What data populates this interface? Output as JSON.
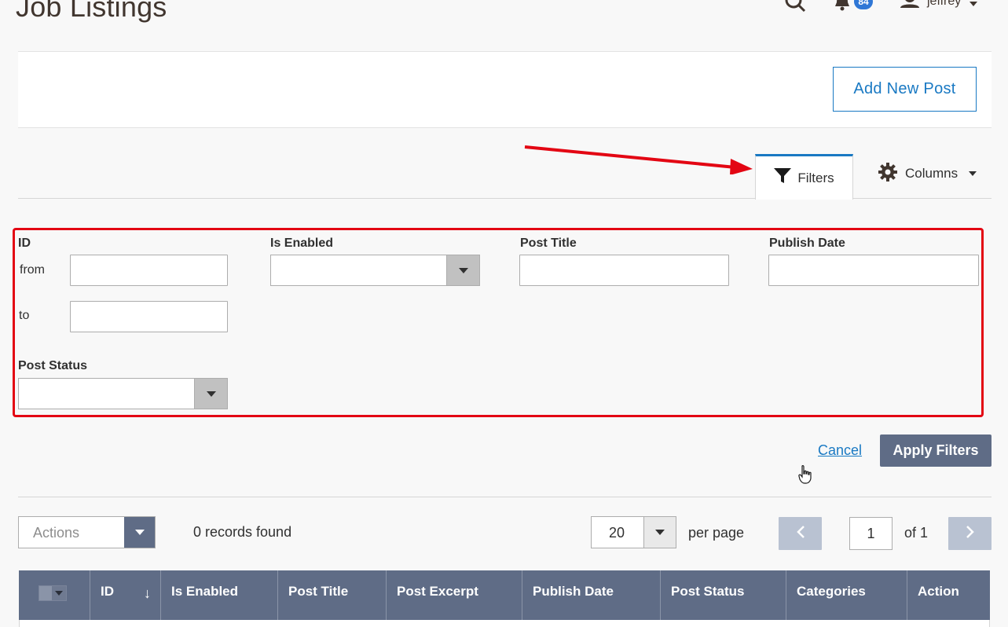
{
  "header": {
    "title": "Job Listings",
    "notifications_count": "84",
    "user_name": "jeffrey"
  },
  "toolbar": {
    "add_new_post_label": "Add New Post"
  },
  "tabs": {
    "filters_label": "Filters",
    "columns_label": "Columns"
  },
  "filters": {
    "id_label": "ID",
    "from_label": "from",
    "to_label": "to",
    "is_enabled_label": "Is Enabled",
    "post_title_label": "Post Title",
    "publish_date_label": "Publish Date",
    "post_status_label": "Post Status",
    "cancel_label": "Cancel",
    "apply_label": "Apply Filters"
  },
  "grid_controls": {
    "actions_placeholder": "Actions",
    "records_found": "0 records found",
    "page_size": "20",
    "per_page_label": "per page",
    "current_page": "1",
    "of_pages": "of 1"
  },
  "grid": {
    "columns": [
      "ID",
      "Is Enabled",
      "Post Title",
      "Post Excerpt",
      "Publish Date",
      "Post Status",
      "Categories",
      "Action"
    ],
    "sort_indicator": "↓"
  },
  "colors": {
    "accent": "#1979c3",
    "header_bg": "#5f6c86",
    "highlight": "#e30613"
  }
}
